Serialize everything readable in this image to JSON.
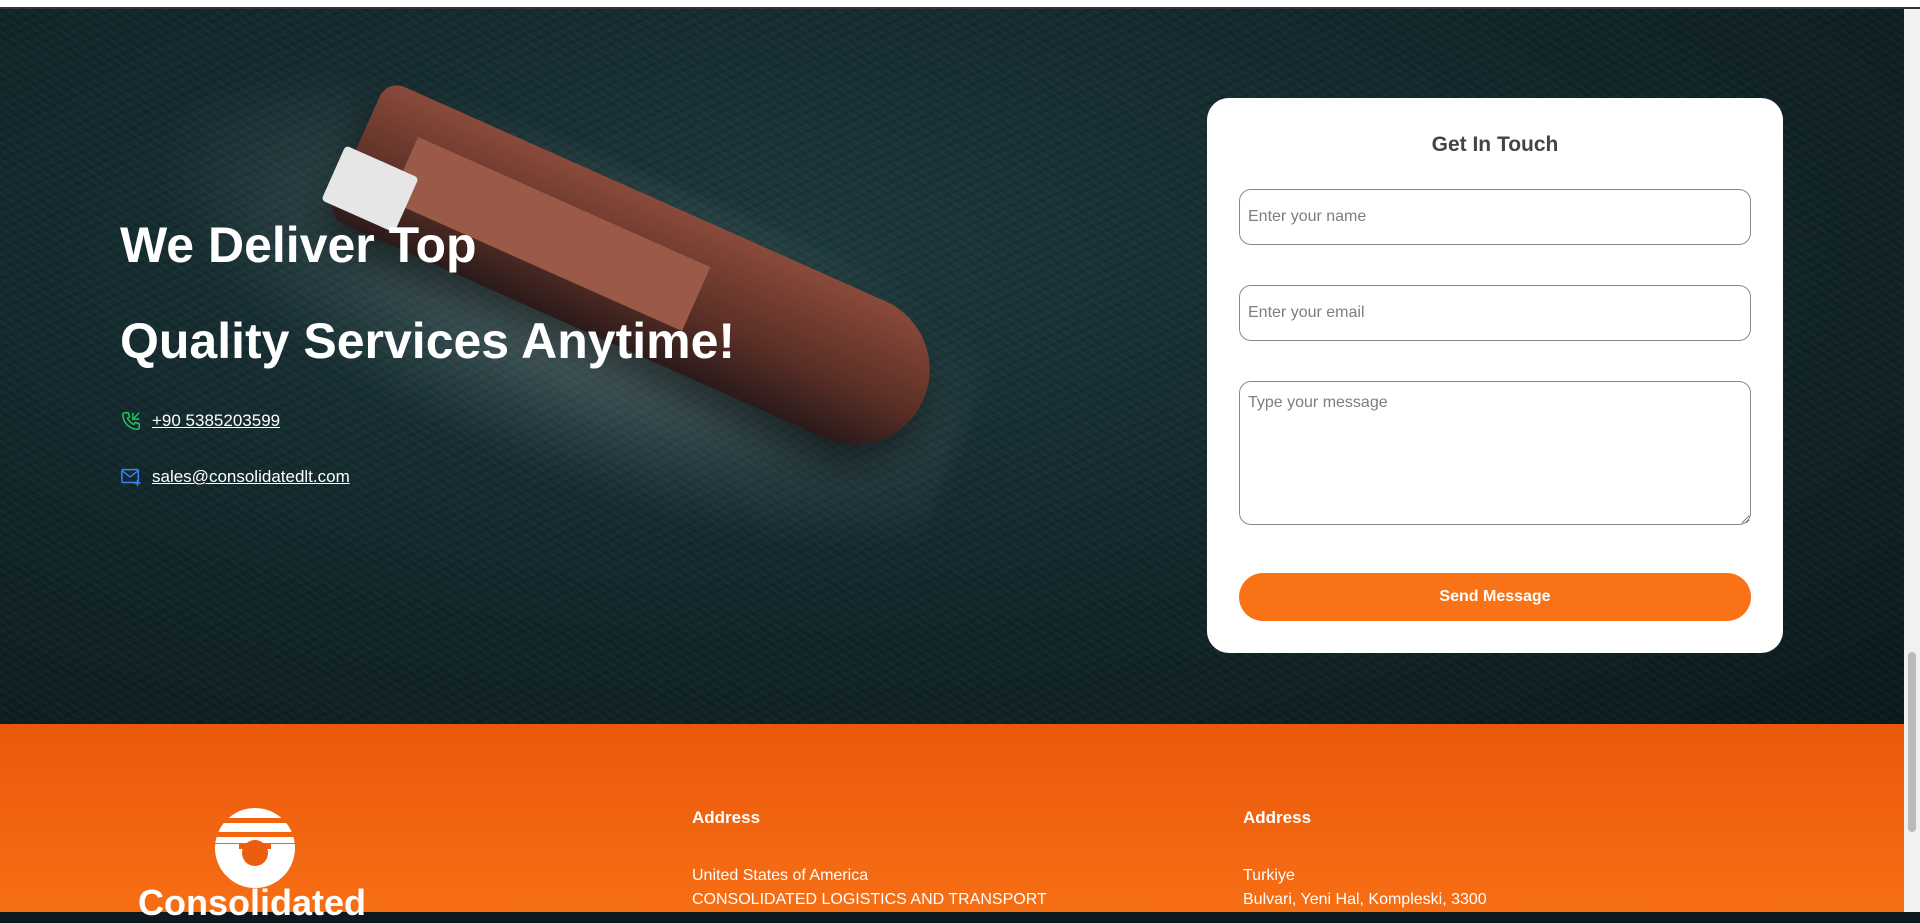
{
  "hero": {
    "title_line1": "We Deliver Top",
    "title_line2": "Quality Services Anytime!",
    "phone": "+90 5385203599",
    "email": "sales@consolidatedlt.com"
  },
  "contact_form": {
    "title": "Get In Touch",
    "name_placeholder": "Enter your name",
    "email_placeholder": "Enter your email",
    "message_placeholder": "Type your message",
    "submit_label": "Send Message"
  },
  "footer": {
    "logo_text": "Consolidated",
    "addresses": [
      {
        "heading": "Address",
        "line1": "United States of America",
        "line2": "CONSOLIDATED LOGISTICS AND TRANSPORT"
      },
      {
        "heading": "Address",
        "line1": "Turkiye",
        "line2": "Bulvari, Yeni Hal, Kompleski, 3300"
      }
    ]
  },
  "colors": {
    "accent": "#f97316",
    "footer_bg": "#ea580c",
    "phone_icon": "#22c55e",
    "mail_icon": "#3b82f6"
  },
  "icons": {
    "phone": "phone-icon",
    "mail": "mail-icon",
    "logo": "logo-mark-icon"
  }
}
